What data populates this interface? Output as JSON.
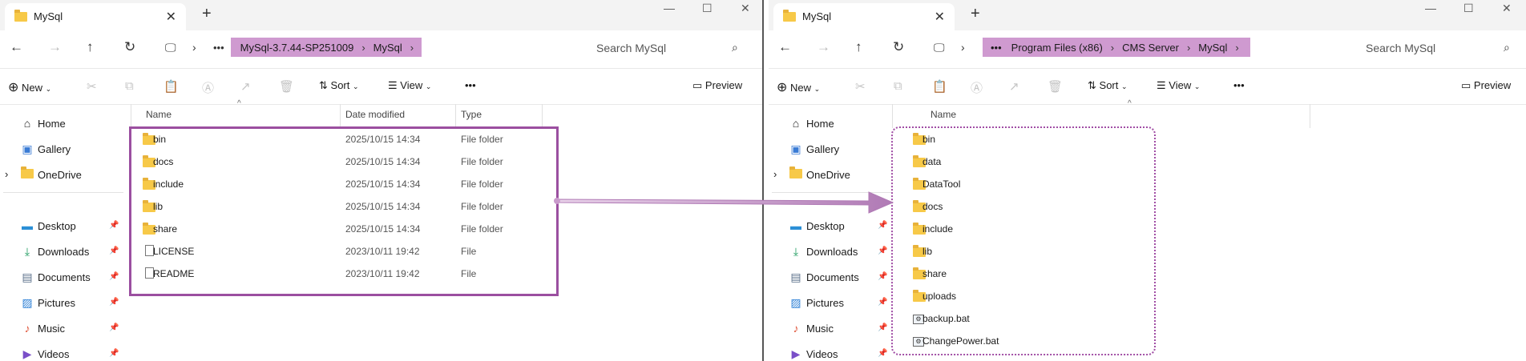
{
  "left": {
    "tab_title": "MySql",
    "breadcrumb": [
      "MySql-3.7.44-SP251009",
      "MySql"
    ],
    "search_placeholder": "Search MySql",
    "toolbar": {
      "new": "New",
      "sort": "Sort",
      "view": "View",
      "more": "•••",
      "preview": "Preview"
    },
    "columns": {
      "name": "Name",
      "date": "Date modified",
      "type": "Type"
    },
    "files": [
      {
        "name": "bin",
        "date": "2025/10/15 14:34",
        "type": "File folder",
        "kind": "folder"
      },
      {
        "name": "docs",
        "date": "2025/10/15 14:34",
        "type": "File folder",
        "kind": "folder"
      },
      {
        "name": "include",
        "date": "2025/10/15 14:34",
        "type": "File folder",
        "kind": "folder"
      },
      {
        "name": "lib",
        "date": "2025/10/15 14:34",
        "type": "File folder",
        "kind": "folder"
      },
      {
        "name": "share",
        "date": "2025/10/15 14:34",
        "type": "File folder",
        "kind": "folder"
      },
      {
        "name": "LICENSE",
        "date": "2023/10/11 19:42",
        "type": "File",
        "kind": "file"
      },
      {
        "name": "README",
        "date": "2023/10/11 19:42",
        "type": "File",
        "kind": "file"
      }
    ]
  },
  "right": {
    "tab_title": "MySql",
    "breadcrumb": [
      "Program Files (x86)",
      "CMS Server",
      "MySql"
    ],
    "search_placeholder": "Search MySql",
    "toolbar": {
      "new": "New",
      "sort": "Sort",
      "view": "View",
      "more": "•••",
      "preview": "Preview"
    },
    "columns": {
      "name": "Name"
    },
    "files": [
      {
        "name": "bin",
        "kind": "folder"
      },
      {
        "name": "data",
        "kind": "folder"
      },
      {
        "name": "DataTool",
        "kind": "folder"
      },
      {
        "name": "docs",
        "kind": "folder"
      },
      {
        "name": "include",
        "kind": "folder"
      },
      {
        "name": "lib",
        "kind": "folder"
      },
      {
        "name": "share",
        "kind": "folder"
      },
      {
        "name": "uploads",
        "kind": "folder"
      },
      {
        "name": "backup.bat",
        "kind": "bat"
      },
      {
        "name": "ChangePower.bat",
        "kind": "bat"
      }
    ]
  },
  "nav_pane": {
    "home": "Home",
    "gallery": "Gallery",
    "onedrive": "OneDrive",
    "desktop": "Desktop",
    "downloads": "Downloads",
    "documents": "Documents",
    "pictures": "Pictures",
    "music": "Music",
    "videos": "Videos"
  },
  "breadcrumb_overflow": "•••",
  "colors": {
    "highlight": "#cf9ad0",
    "box": "#9b4fa0",
    "arrow": "#b07ab5",
    "folder": "#f7c948"
  }
}
